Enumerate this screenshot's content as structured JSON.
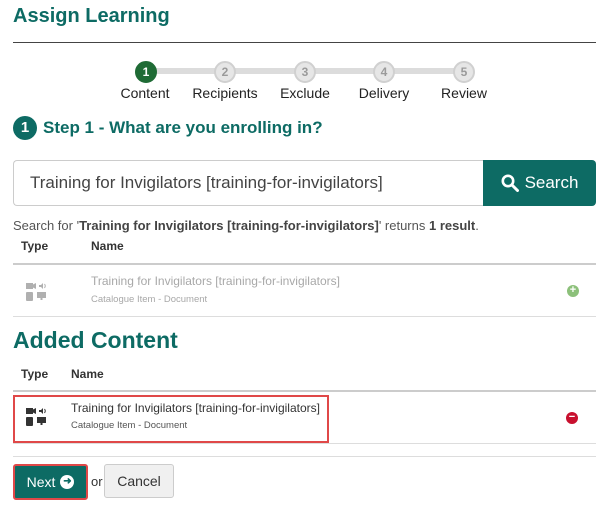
{
  "page": {
    "title": "Assign Learning"
  },
  "stepper": {
    "steps": [
      {
        "number": "1",
        "label": "Content",
        "active": true
      },
      {
        "number": "2",
        "label": "Recipients",
        "active": false
      },
      {
        "number": "3",
        "label": "Exclude",
        "active": false
      },
      {
        "number": "4",
        "label": "Delivery",
        "active": false
      },
      {
        "number": "5",
        "label": "Review",
        "active": false
      }
    ]
  },
  "step_heading": {
    "number": "1",
    "text": "Step 1 - What are you enrolling in?"
  },
  "search": {
    "value": "Training for Invigilators [training-for-invigilators]",
    "button_label": "Search",
    "summary_prefix": "Search for '",
    "summary_query": "Training for Invigilators [training-for-invigilators]",
    "summary_mid": "' returns ",
    "summary_count": "1 result",
    "summary_suffix": "."
  },
  "results_table": {
    "columns": [
      "Type",
      "Name"
    ],
    "rows": [
      {
        "title": "Training for Invigilators [training-for-invigilators]",
        "subtitle": "Catalogue Item - Document",
        "type_icon": "media-document-icon",
        "action_icon": "add-icon"
      }
    ]
  },
  "added_content": {
    "heading": "Added Content",
    "columns": [
      "Type",
      "Name"
    ],
    "rows": [
      {
        "title": "Training for Invigilators [training-for-invigilators]",
        "subtitle": "Catalogue Item - Document",
        "type_icon": "media-document-icon",
        "action_icon": "remove-icon"
      }
    ]
  },
  "actions": {
    "next_label": "Next",
    "or_label": "or",
    "cancel_label": "Cancel"
  },
  "colors": {
    "brand": "#0d6b64",
    "active_step": "#1f6b35",
    "highlight": "#e04848",
    "remove": "#c8102e",
    "add": "#8cc07a"
  }
}
